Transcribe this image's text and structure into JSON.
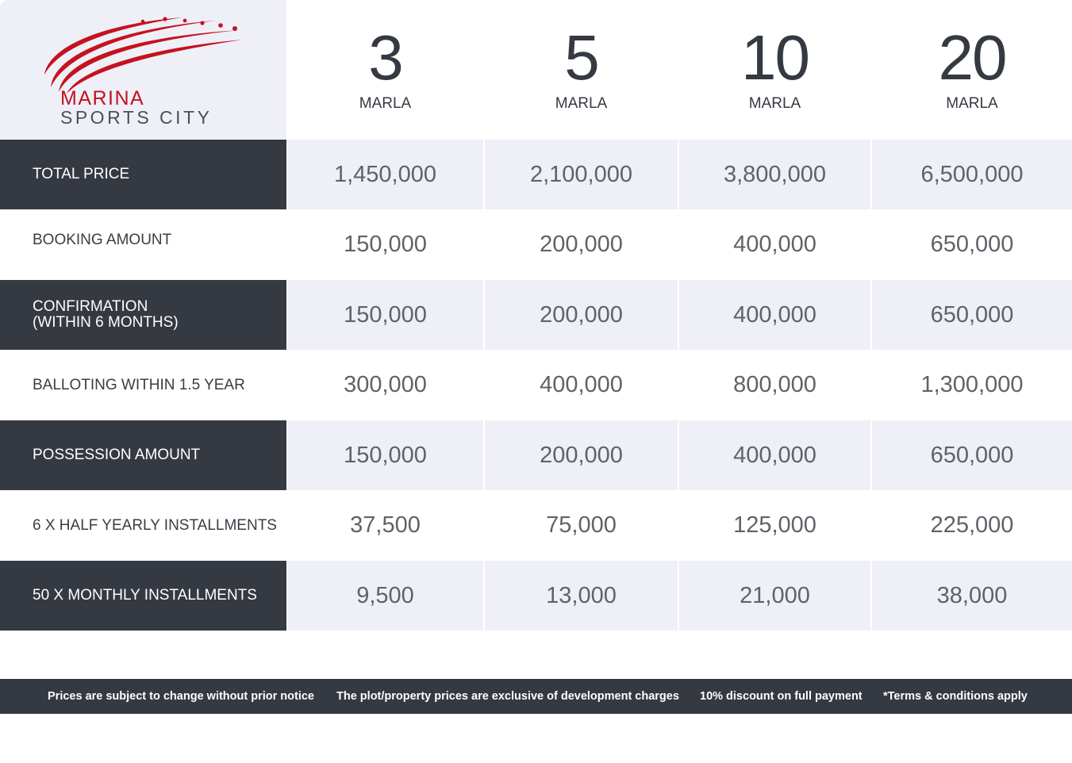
{
  "logo": {
    "line1": "MARINA",
    "line2": "SPORTS CITY",
    "accent_color": "#c4121f",
    "icon": "swoosh-lines-logo"
  },
  "sizes": [
    {
      "number": "3",
      "unit": "MARLA"
    },
    {
      "number": "5",
      "unit": "MARLA"
    },
    {
      "number": "10",
      "unit": "MARLA"
    },
    {
      "number": "20",
      "unit": "MARLA"
    }
  ],
  "rows": [
    {
      "label": "TOTAL PRICE",
      "values": [
        "1,450,000",
        "2,100,000",
        "3,800,000",
        "6,500,000"
      ]
    },
    {
      "label": "BOOKING AMOUNT",
      "values": [
        "150,000",
        "200,000",
        "400,000",
        "650,000"
      ]
    },
    {
      "label": "CONFIRMATION",
      "label2": "(WITHIN 6 MONTHS)",
      "values": [
        "150,000",
        "200,000",
        "400,000",
        "650,000"
      ]
    },
    {
      "label": "BALLOTING WITHIN 1.5 YEAR",
      "values": [
        "300,000",
        "400,000",
        "800,000",
        "1,300,000"
      ]
    },
    {
      "label": "POSSESSION AMOUNT",
      "values": [
        "150,000",
        "200,000",
        "400,000",
        "650,000"
      ]
    },
    {
      "label": "6 X HALF YEARLY INSTALLMENTS",
      "values": [
        "37,500",
        "75,000",
        "125,000",
        "225,000"
      ]
    },
    {
      "label": "50 X MONTHLY INSTALLMENTS",
      "values": [
        "9,500",
        "13,000",
        "21,000",
        "38,000"
      ]
    }
  ],
  "footer": {
    "notes": [
      "Prices are subject to change without prior notice",
      "The plot/property prices are exclusive of development charges",
      "10% discount on full payment",
      "*Terms & conditions apply"
    ]
  },
  "colors": {
    "dark": "#353941",
    "shade": "#efeff7",
    "value_text": "#606268"
  }
}
